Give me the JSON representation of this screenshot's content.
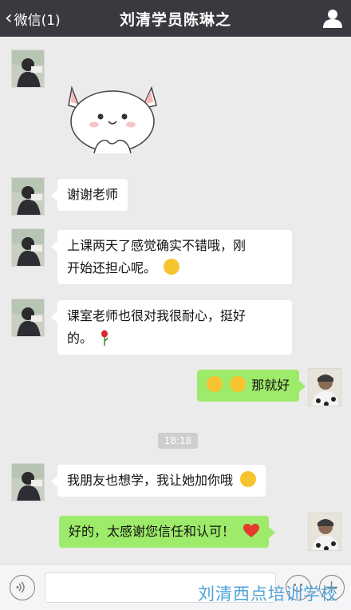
{
  "header": {
    "back_label": "微信(1)",
    "title": "刘清学员陈琳之"
  },
  "messages": [
    {
      "side": "left",
      "type": "sticker",
      "sticker": "white-cat-sticker"
    },
    {
      "side": "left",
      "type": "text",
      "text": "谢谢老师"
    },
    {
      "side": "left",
      "type": "text",
      "line1": "上课两天了感觉确实不错哦，刚",
      "line2": "开始还担心呢。",
      "emoji": "tongue-wink-emoji"
    },
    {
      "side": "left",
      "type": "text",
      "line1": "课室老师也很对我很耐心，挺好",
      "line2": "的。",
      "emoji": "rose-emoji"
    },
    {
      "side": "right",
      "type": "text",
      "text": "那就好",
      "emoji": "smile-emoji x2"
    },
    {
      "side": "left",
      "type": "text",
      "text": "我朋友也想学，我让她加你哦",
      "emoji": "smile-emoji"
    },
    {
      "side": "right",
      "type": "text",
      "text": "好的，太感谢您信任和认可！",
      "emoji": "heart-emoji"
    }
  ],
  "timestamp": "18:18",
  "watermark": "刘清西点培训学校",
  "colors": {
    "topbar": "#393a3f",
    "chat_bg": "#ebebeb",
    "bubble_right": "#9eea6a",
    "bubble_left": "#ffffff",
    "watermark": "#4ea3d9"
  }
}
